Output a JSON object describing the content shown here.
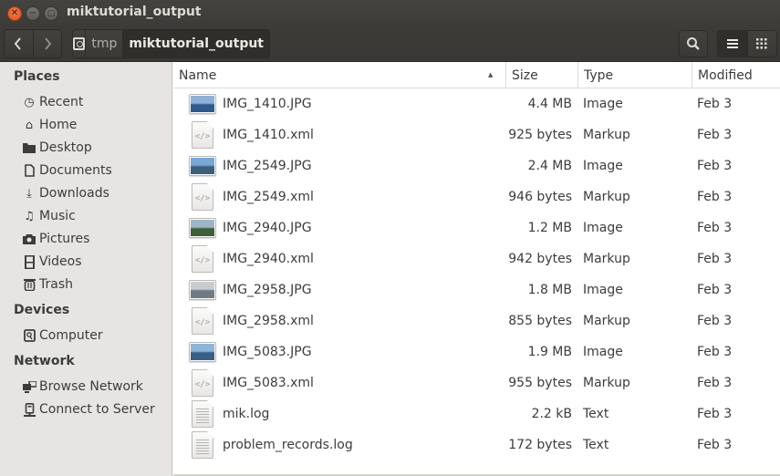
{
  "window": {
    "title": "miktutorial_output"
  },
  "toolbar": {
    "back_icon": "chevron-left-icon",
    "forward_icon": "chevron-right-icon",
    "path": [
      {
        "label": "tmp",
        "active": false
      },
      {
        "label": "miktutorial_output",
        "active": true
      }
    ],
    "search_icon": "search-icon",
    "view_list_icon": "list-view-icon",
    "view_grid_icon": "grid-view-icon"
  },
  "sidebar": {
    "sections": [
      {
        "heading": "Places",
        "items": [
          {
            "label": "Recent",
            "icon": "clock-icon"
          },
          {
            "label": "Home",
            "icon": "home-icon"
          },
          {
            "label": "Desktop",
            "icon": "folder-icon"
          },
          {
            "label": "Documents",
            "icon": "document-icon"
          },
          {
            "label": "Downloads",
            "icon": "download-icon"
          },
          {
            "label": "Music",
            "icon": "music-icon"
          },
          {
            "label": "Pictures",
            "icon": "camera-icon"
          },
          {
            "label": "Videos",
            "icon": "film-icon"
          },
          {
            "label": "Trash",
            "icon": "trash-icon"
          }
        ]
      },
      {
        "heading": "Devices",
        "items": [
          {
            "label": "Computer",
            "icon": "harddisk-icon"
          }
        ]
      },
      {
        "heading": "Network",
        "items": [
          {
            "label": "Browse Network",
            "icon": "network-icon"
          },
          {
            "label": "Connect to Server",
            "icon": "server-icon"
          }
        ]
      }
    ]
  },
  "columns": {
    "name": "Name",
    "size": "Size",
    "type": "Type",
    "modified": "Modified",
    "sort_indicator": "▲"
  },
  "files": [
    {
      "name": "IMG_1410.JPG",
      "size": "4.4 MB",
      "type": "Image",
      "modified": "Feb 3",
      "icon": "image-thumbnail",
      "thumb": [
        "#8fb1d6",
        "#2f5a8c"
      ]
    },
    {
      "name": "IMG_1410.xml",
      "size": "925 bytes",
      "type": "Markup",
      "modified": "Feb 3",
      "icon": "markup-file-icon"
    },
    {
      "name": "IMG_2549.JPG",
      "size": "2.4 MB",
      "type": "Image",
      "modified": "Feb 3",
      "icon": "image-thumbnail",
      "thumb": [
        "#7aa6d8",
        "#3e5f7c"
      ]
    },
    {
      "name": "IMG_2549.xml",
      "size": "946 bytes",
      "type": "Markup",
      "modified": "Feb 3",
      "icon": "markup-file-icon"
    },
    {
      "name": "IMG_2940.JPG",
      "size": "1.2 MB",
      "type": "Image",
      "modified": "Feb 3",
      "icon": "image-thumbnail",
      "thumb": [
        "#9fb6c6",
        "#3f5f3a"
      ]
    },
    {
      "name": "IMG_2940.xml",
      "size": "942 bytes",
      "type": "Markup",
      "modified": "Feb 3",
      "icon": "markup-file-icon"
    },
    {
      "name": "IMG_2958.JPG",
      "size": "1.8 MB",
      "type": "Image",
      "modified": "Feb 3",
      "icon": "image-thumbnail",
      "thumb": [
        "#c8ccd0",
        "#6f7a85"
      ]
    },
    {
      "name": "IMG_2958.xml",
      "size": "855 bytes",
      "type": "Markup",
      "modified": "Feb 3",
      "icon": "markup-file-icon"
    },
    {
      "name": "IMG_5083.JPG",
      "size": "1.9 MB",
      "type": "Image",
      "modified": "Feb 3",
      "icon": "image-thumbnail",
      "thumb": [
        "#8fb4da",
        "#3b5e86"
      ]
    },
    {
      "name": "IMG_5083.xml",
      "size": "955 bytes",
      "type": "Markup",
      "modified": "Feb 3",
      "icon": "markup-file-icon"
    },
    {
      "name": "mik.log",
      "size": "2.2 kB",
      "type": "Text",
      "modified": "Feb 3",
      "icon": "text-file-icon"
    },
    {
      "name": "problem_records.log",
      "size": "172 bytes",
      "type": "Text",
      "modified": "Feb 3",
      "icon": "text-file-icon"
    }
  ]
}
